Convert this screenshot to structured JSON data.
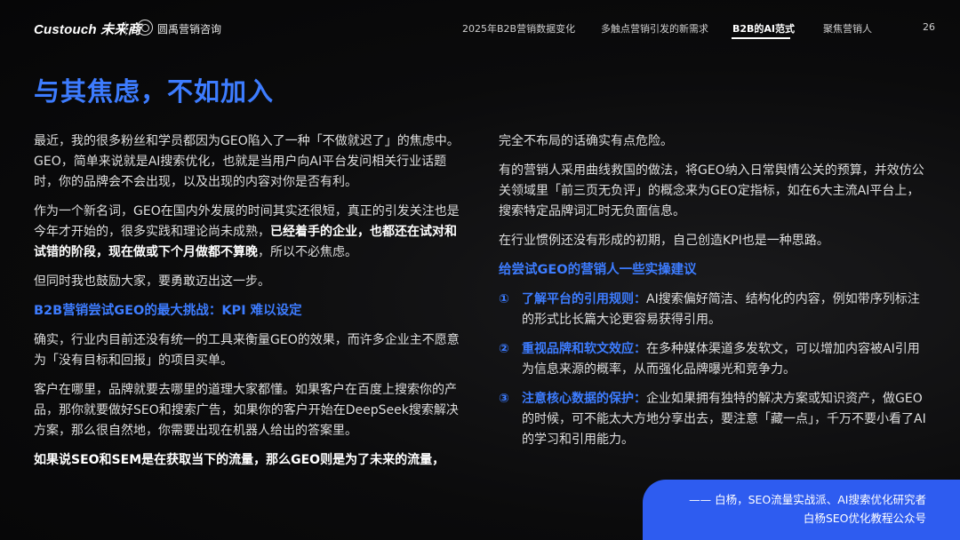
{
  "header": {
    "logo_main": "Custouch 未来商",
    "logo_secondary": "圆禹营销咨询",
    "nav": [
      {
        "label": "2025年B2B营销数据变化",
        "active": false
      },
      {
        "label": "多触点营销引发的新需求",
        "active": false
      },
      {
        "label": "B2B的AI范式",
        "active": true
      },
      {
        "label": "聚焦营销人",
        "active": false
      }
    ],
    "page_number": "26"
  },
  "title": "与其焦虑，不如加入",
  "left": {
    "p1": "最近，我的很多粉丝和学员都因为GEO陷入了一种「不做就迟了」的焦虑中。GEO，简单来说就是AI搜索优化，也就是当用户向AI平台发问相关行业话题时，你的品牌会不会出现，以及出现的内容对你是否有利。",
    "p2_a": "作为一个新名词，GEO在国内外发展的时间其实还很短，真正的引发关注也是今年才开始的，很多实践和理论尚未成熟，",
    "p2_b": "已经着手的企业，也都还在试对和试错的阶段，现在做或下个月做都不算晚",
    "p2_c": "，所以不必焦虑。",
    "p3": "但同时我也鼓励大家，要勇敢迈出这一步。",
    "subheading": "B2B营销尝试GEO的最大挑战：KPI 难以设定",
    "p4": "确实，行业内目前还没有统一的工具来衡量GEO的效果，而许多企业主不愿意为「没有目标和回报」的项目买单。",
    "p5": "客户在哪里，品牌就要去哪里的道理大家都懂。如果客户在百度上搜索你的产品，那你就要做好SEO和搜索广告，如果你的客户开始在DeepSeek搜索解决方案，那么很自然地，你需要出现在机器人给出的答案里。",
    "p6": "如果说SEO和SEM是在获取当下的流量，那么GEO则是为了未来的流量，"
  },
  "right": {
    "p1": "完全不布局的话确实有点危险。",
    "p2": "有的营销人采用曲线救国的做法，将GEO纳入日常舆情公关的预算，并效仿公关领域里「前三页无负评」的概念来为GEO定指标，如在6大主流AI平台上，搜索特定品牌词汇时无负面信息。",
    "p3": "在行业惯例还没有形成的初期，自己创造KPI也是一种思路。",
    "subheading": "给尝试GEO的营销人一些实操建议",
    "tips": [
      {
        "num": "①",
        "head": "了解平台的引用规则：",
        "body": "AI搜索偏好简洁、结构化的内容，例如带序列标注的形式比长篇大论更容易获得引用。"
      },
      {
        "num": "②",
        "head": "重视品牌和软文效应：",
        "body": "在多种媒体渠道多发软文，可以增加内容被AI引用为信息来源的概率，从而强化品牌曝光和竞争力。"
      },
      {
        "num": "③",
        "head": "注意核心数据的保护：",
        "body": "企业如果拥有独特的解决方案或知识资产，做GEO的时候，可不能太大方地分享出去，要注意「藏一点」，千万不要小看了AI的学习和引用能力。"
      }
    ]
  },
  "quote": {
    "line1": "—— 白杨，SEO流量实战派、AI搜索优化研究者",
    "line2": "白杨SEO优化教程公众号"
  },
  "colors": {
    "accent": "#3d7cff",
    "quote_bg": "#2e5cf0",
    "background": "#0b0b0c"
  }
}
